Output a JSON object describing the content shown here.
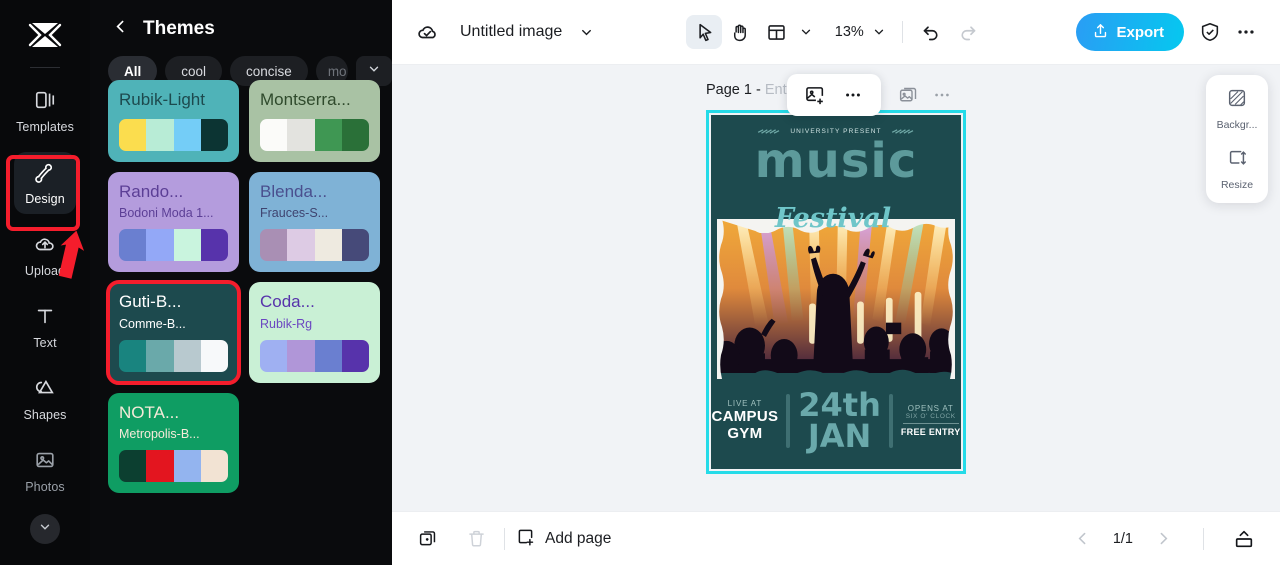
{
  "rail": {
    "logo_icon": "capcut-logo-icon",
    "items": [
      {
        "id": "templates",
        "label": "Templates",
        "icon": "templates-icon",
        "active": false
      },
      {
        "id": "design",
        "label": "Design",
        "icon": "design-icon",
        "active": true
      },
      {
        "id": "upload",
        "label": "Upload",
        "icon": "upload-cloud-icon",
        "active": false
      },
      {
        "id": "text",
        "label": "Text",
        "icon": "text-icon",
        "active": false
      },
      {
        "id": "shapes",
        "label": "Shapes",
        "icon": "shapes-icon",
        "active": false
      },
      {
        "id": "photos",
        "label": "Photos",
        "icon": "photos-icon",
        "active": false
      }
    ],
    "expand_icon": "chevron-down-icon",
    "highlight_color": "#f51d2c"
  },
  "panel": {
    "back_icon": "chevron-left-icon",
    "title": "Themes",
    "chips": [
      {
        "label": "All",
        "selected": true
      },
      {
        "label": "cool",
        "selected": false
      },
      {
        "label": "concise",
        "selected": false
      },
      {
        "label": "mo",
        "selected": false
      }
    ],
    "chip_more_icon": "chevron-down-icon",
    "cards": [
      {
        "t1": "Rubik-Light",
        "t2": "",
        "bg": "#4fb3b8",
        "fg": "#1d4a4e",
        "fg2": "#1d4a4e",
        "swatches": [
          "#fbdd4e",
          "#b8ecd6",
          "#74cdf7",
          "#0c3433"
        ],
        "selected": false,
        "clip_top": true
      },
      {
        "t1": "Montserra...",
        "t2": "",
        "bg": "#a9c2a4",
        "fg": "#2f4a2c",
        "fg2": "#2f4a2c",
        "swatches": [
          "#fbfbf9",
          "#e3e3df",
          "#3f9753",
          "#2a7038"
        ],
        "selected": false,
        "clip_top": true
      },
      {
        "t1": "Rando...",
        "t2": "Bodoni Moda 1...",
        "bg": "#b49cdd",
        "fg": "#5c3f96",
        "fg2": "#5c3f96",
        "swatches": [
          "#6a7fd0",
          "#93a8f7",
          "#c9f4de",
          "#5733ab"
        ],
        "selected": false,
        "clip_top": false
      },
      {
        "t1": "Blenda...",
        "t2": "Frauces-S...",
        "bg": "#7fb2d6",
        "fg": "#4a4f8e",
        "fg2": "#3f4470",
        "swatches": [
          "#a98fb4",
          "#ddcbe4",
          "#eeeae0",
          "#464a79"
        ],
        "selected": false,
        "clip_top": false
      },
      {
        "t1": "Guti-B...",
        "t2": "Comme-B...",
        "bg": "#1d4a4e",
        "fg": "#ffffff",
        "fg2": "#ffffff",
        "swatches": [
          "#19847f",
          "#6aa9aa",
          "#b8c9cf",
          "#f7f9fa"
        ],
        "selected": true,
        "clip_top": false
      },
      {
        "t1": "Coda...",
        "t2": "Rubik-Rg",
        "bg": "#c9f0d5",
        "fg": "#5733ab",
        "fg2": "#6b46c1",
        "swatches": [
          "#9fb0f2",
          "#b096d8",
          "#6a7fd0",
          "#5733ab"
        ],
        "selected": false,
        "clip_top": false
      },
      {
        "t1": "NOTA...",
        "t2": "Metropolis-B...",
        "bg": "#0f9d63",
        "fg": "#f5ead9",
        "fg2": "#f5ead9",
        "swatches": [
          "#0c3f30",
          "#e3151f",
          "#93b4ef",
          "#f2e3d3"
        ],
        "selected": false,
        "clip_top": false
      }
    ],
    "collapse_icon": "chevron-left-icon"
  },
  "topbar": {
    "cloud_icon": "cloud-saved-icon",
    "doc_name": "Untitled image",
    "doc_caret_icon": "chevron-down-icon",
    "tools": [
      {
        "id": "select",
        "icon": "cursor-arrow-icon",
        "active": true
      },
      {
        "id": "hand",
        "icon": "hand-icon",
        "active": false
      },
      {
        "id": "layout",
        "icon": "layout-grid-icon",
        "active": false
      }
    ],
    "layout_caret_icon": "chevron-down-icon",
    "zoom": "13%",
    "zoom_caret_icon": "chevron-down-icon",
    "undo_icon": "undo-icon",
    "redo_icon": "redo-icon",
    "export_label": "Export",
    "export_icon": "share-up-icon",
    "export_color": "#05c8ef",
    "shield_icon": "shield-check-icon",
    "more_icon": "more-horizontal-icon"
  },
  "canvas": {
    "page_label": "Page 1 -",
    "page_placeholder": "Enter page name",
    "float_toolbar": [
      {
        "id": "add-image",
        "icon": "add-image-icon"
      },
      {
        "id": "more",
        "icon": "more-horizontal-icon"
      }
    ],
    "page_icons": [
      {
        "id": "duplicate-page",
        "icon": "duplicate-image-icon"
      },
      {
        "id": "page-more",
        "icon": "more-horizontal-icon"
      }
    ],
    "selection_color": "#25dbe8"
  },
  "poster": {
    "present": "UNIVERSITY PRESENT",
    "title": "music",
    "subtitle": "Festival",
    "live_at_label": "LIVE AT",
    "venue_line1": "CAMPUS",
    "venue_line2": "GYM",
    "date_day": "24th",
    "date_month": "JAN",
    "opens_at_label": "OPENS AT",
    "opens_time": "SIX O' CLOCK",
    "free_entry": "FREE ENTRY",
    "bg_color": "#1d4a4e"
  },
  "right_panel": {
    "items": [
      {
        "id": "background",
        "label": "Backgr...",
        "icon": "background-pattern-icon"
      },
      {
        "id": "resize",
        "label": "Resize",
        "icon": "resize-icon"
      }
    ]
  },
  "bottombar": {
    "duplicate_icon": "duplicate-page-icon",
    "delete_icon": "trash-icon",
    "add_page_icon": "add-page-icon",
    "add_page_label": "Add page",
    "prev_icon": "chevron-left-icon",
    "page_indicator": "1/1",
    "next_icon": "chevron-right-icon",
    "panel_toggle_icon": "collapse-panel-icon"
  }
}
